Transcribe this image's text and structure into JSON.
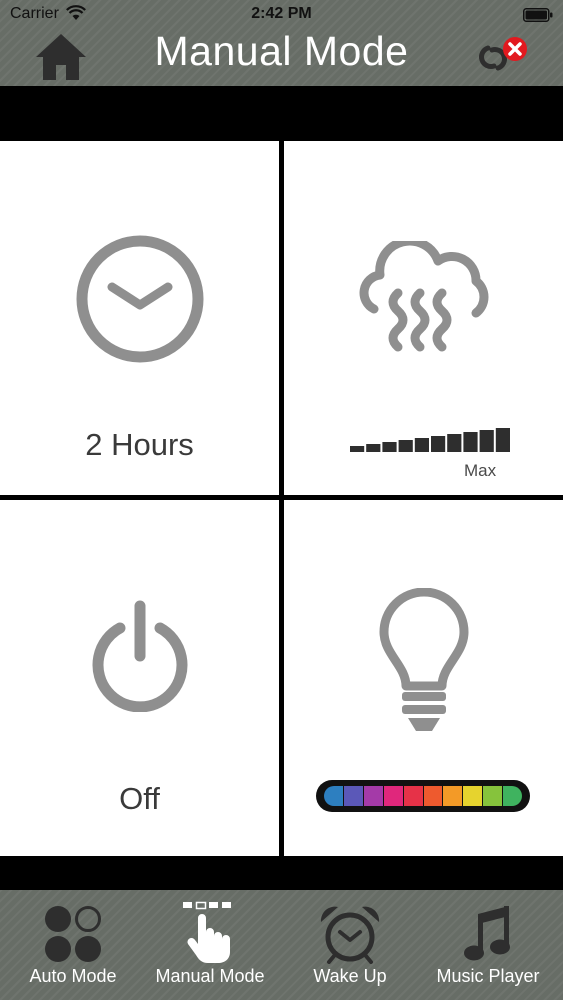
{
  "status_bar": {
    "carrier": "Carrier",
    "time": "2:42 PM"
  },
  "header": {
    "title": "Manual Mode"
  },
  "tiles": {
    "timer": {
      "value": "2 Hours"
    },
    "mist": {
      "level_label": "Max",
      "level": 1.0,
      "bar_count": 10
    },
    "power": {
      "value": "Off"
    },
    "light": {
      "colors": [
        "#2d7fc0",
        "#5b58b8",
        "#a43aa8",
        "#e0277c",
        "#e63248",
        "#ee5a2e",
        "#f39a27",
        "#e6d32e",
        "#86c33c",
        "#3fb35f"
      ]
    }
  },
  "tab_bar": {
    "tabs": [
      {
        "label": "Auto Mode"
      },
      {
        "label": "Manual Mode"
      },
      {
        "label": "Wake Up"
      },
      {
        "label": "Music Player"
      }
    ]
  },
  "colors": {
    "bar": "#676d66",
    "icon_gray": "#8f8f8f",
    "dark_icon": "#2e2e2e",
    "alert_red": "#e2191f"
  }
}
